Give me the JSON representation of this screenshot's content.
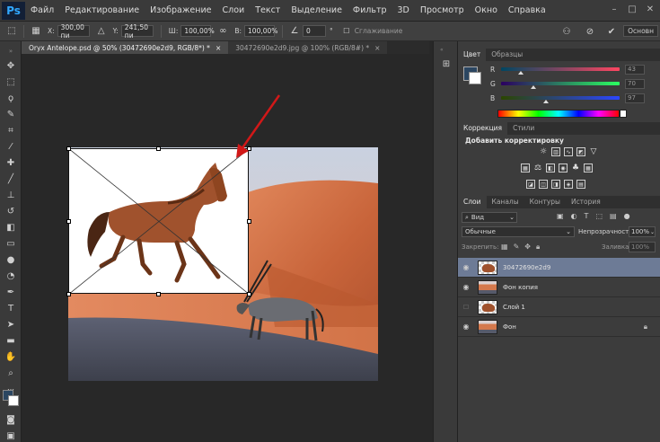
{
  "app": {
    "logo": "Ps",
    "menu": [
      "Файл",
      "Редактирование",
      "Изображение",
      "Слои",
      "Текст",
      "Выделение",
      "Фильтр",
      "3D",
      "Просмотр",
      "Окно",
      "Справка"
    ]
  },
  "options_bar": {
    "x_label": "X:",
    "x_value": "300,00 пи",
    "y_label": "Y:",
    "y_value": "241,50 пи",
    "w_label": "Ш:",
    "w_value": "100,00%",
    "h_label": "В:",
    "h_value": "100,00%",
    "angle_value": "0",
    "angle_unit": "°",
    "antialias_label": "Сглаживание",
    "essentials": "Основн"
  },
  "tabs": [
    {
      "label": "Oryx Antelope.psd @ 50% (30472690e2d9, RGB/8*) *",
      "active": true
    },
    {
      "label": "30472690e2d9.jpg @ 100% (RGB/8#) *",
      "active": false
    }
  ],
  "color_panel": {
    "tabs": [
      "Цвет",
      "Образцы"
    ],
    "channels": [
      {
        "label": "R",
        "value": "43",
        "level": 0.17
      },
      {
        "label": "G",
        "value": "70",
        "level": 0.27
      },
      {
        "label": "B",
        "value": "97",
        "level": 0.38
      }
    ],
    "foreground": "#2b4661",
    "background": "#ffffff"
  },
  "adjustments_panel": {
    "tabs": [
      "Коррекция",
      "Стили"
    ],
    "title": "Добавить корректировку"
  },
  "layers_panel": {
    "tabs": [
      "Слои",
      "Каналы",
      "Контуры",
      "История"
    ],
    "filter_label": "Вид",
    "blend_mode": "Обычные",
    "opacity_label": "Непрозрачность:",
    "opacity_value": "100%",
    "lock_label": "Закрепить:",
    "fill_label": "Заливка:",
    "fill_value": "100%",
    "layers": [
      {
        "name": "30472690e2d9",
        "visible": true,
        "selected": true,
        "thumb": "horse"
      },
      {
        "name": "Фон копия",
        "visible": true,
        "selected": false,
        "thumb": "dune"
      },
      {
        "name": "Слой 1",
        "visible": false,
        "selected": false,
        "thumb": "horse"
      },
      {
        "name": "Фон",
        "visible": true,
        "selected": false,
        "thumb": "dune",
        "locked": true
      }
    ]
  },
  "colors": {
    "accent": "#31a8ff",
    "selected_layer": "#6d7b96",
    "panel_bg": "#3c3c3c",
    "canvas_bg": "#282828",
    "arrow": "#d11818"
  }
}
